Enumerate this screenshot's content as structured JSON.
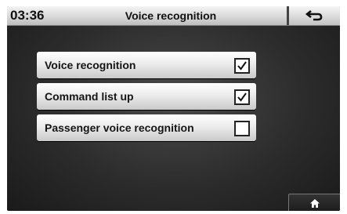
{
  "header": {
    "time": "03:36",
    "title": "Voice recognition",
    "back_icon": "back-arrow-icon"
  },
  "options": [
    {
      "label": "Voice recognition",
      "checked": true
    },
    {
      "label": "Command list up",
      "checked": true
    },
    {
      "label": "Passenger voice recognition",
      "checked": false
    }
  ],
  "footer": {
    "home_icon": "home-icon"
  },
  "colors": {
    "header_bg": "#d8d8d8",
    "screen_bg": "#2c2c2c",
    "option_bg": "#ececec",
    "text": "#151515"
  }
}
